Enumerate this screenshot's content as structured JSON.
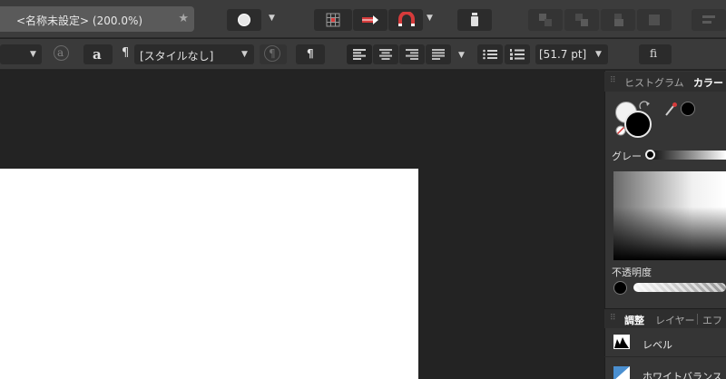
{
  "document": {
    "tab_title": "<名称未設定> (200.0%)",
    "tab_star": "★"
  },
  "toolbar": {
    "dropdown_arrow": "▼"
  },
  "context_bar": {
    "a_outline": "a",
    "a_plain": "a",
    "pilcrow": "¶",
    "style_value": "[スタイルなし]",
    "size_value": "[51.7 pt]",
    "ligature": "ﬁ"
  },
  "panel": {
    "tab_histogram": "ヒストグラム",
    "tab_color": "カラー",
    "gray_label": "グレー",
    "opacity_label": "不透明度",
    "adj_tab": "調整",
    "layer_tab": "レイヤー",
    "effect_tab": "エフ",
    "adj_items": [
      {
        "label": "レベル"
      },
      {
        "label": "ホワイトバランス"
      }
    ]
  },
  "colors": {
    "accent_red": "#d63b3b",
    "panel_bg": "#353535",
    "canvas_bg": "#232323"
  }
}
